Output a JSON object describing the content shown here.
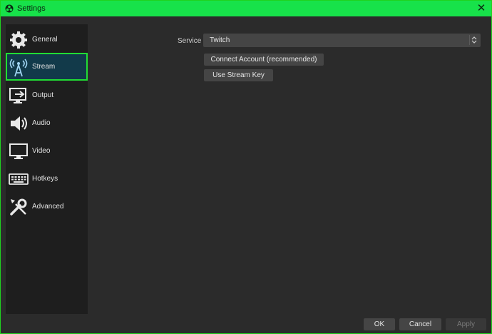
{
  "window": {
    "title": "Settings"
  },
  "sidebar": {
    "items": [
      {
        "label": "General",
        "icon": "gear-icon"
      },
      {
        "label": "Stream",
        "icon": "broadcast-antenna-icon",
        "selected": true
      },
      {
        "label": "Output",
        "icon": "output-monitor-icon"
      },
      {
        "label": "Audio",
        "icon": "speaker-icon"
      },
      {
        "label": "Video",
        "icon": "monitor-icon"
      },
      {
        "label": "Hotkeys",
        "icon": "keyboard-icon"
      },
      {
        "label": "Advanced",
        "icon": "tools-icon"
      }
    ]
  },
  "stream": {
    "service_label": "Service",
    "service_value": "Twitch",
    "connect_account_label": "Connect Account (recommended)",
    "use_stream_key_label": "Use Stream Key"
  },
  "footer": {
    "ok_label": "OK",
    "cancel_label": "Cancel",
    "apply_label": "Apply"
  },
  "colors": {
    "accent": "#17e24a",
    "selected_bg": "#123a4a",
    "highlight_border": "#21dd34"
  }
}
